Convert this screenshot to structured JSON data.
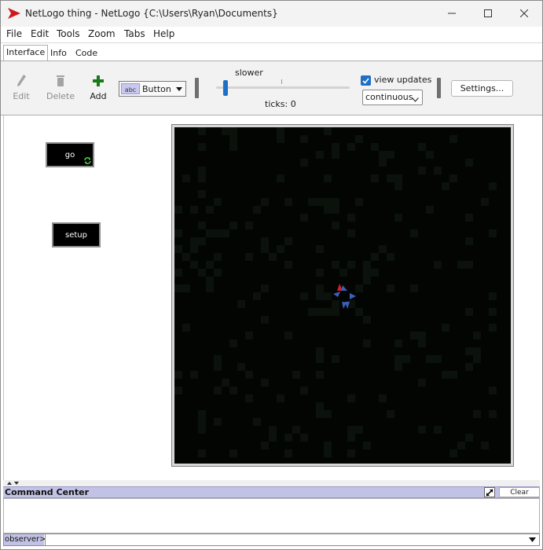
{
  "window": {
    "title": "NetLogo thing - NetLogo {C:\\Users\\Ryan\\Documents}",
    "controls": [
      "minimize-icon",
      "maximize-icon",
      "close-icon"
    ]
  },
  "menubar": {
    "items": [
      "File",
      "Edit",
      "Tools",
      "Zoom",
      "Tabs",
      "Help"
    ]
  },
  "tabs": [
    {
      "label": "Interface",
      "active": true
    },
    {
      "label": "Info",
      "active": false
    },
    {
      "label": "Code",
      "active": false
    }
  ],
  "toolbar": {
    "edit_label": "Edit",
    "delete_label": "Delete",
    "add_label": "Add",
    "widget_type": "Button",
    "speed_label": "slower",
    "speed_value": 0.05,
    "ticks_text": "ticks: 0",
    "view_updates_label": "view updates",
    "view_updates_checked": true,
    "update_mode": "continuous",
    "settings_label": "Settings..."
  },
  "widgets": {
    "go_button": {
      "label": "go",
      "forever": true
    },
    "setup_button": {
      "label": "setup",
      "forever": false
    }
  },
  "world": {
    "background": "#000000",
    "turtle_colors": [
      "#3a5fbf",
      "#d02020"
    ]
  },
  "command_center": {
    "title": "Command Center",
    "clear_label": "Clear",
    "prompt": "observer>",
    "input_value": ""
  },
  "colors": {
    "accent": "#1f6fc7",
    "command_center_header": "#c2c2e6",
    "add_icon": "#1a7a1a",
    "title_logo": "#d01818"
  }
}
